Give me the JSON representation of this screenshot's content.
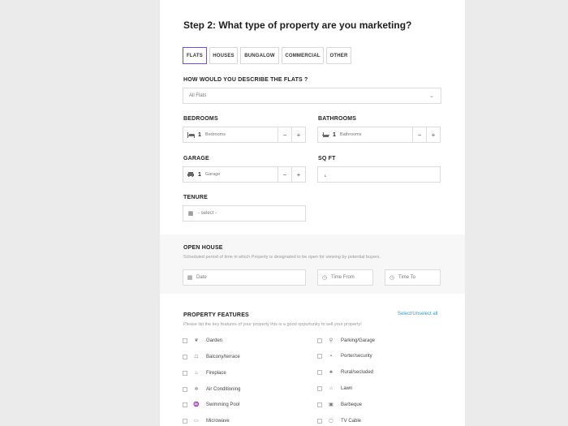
{
  "heading": "Step 2: What type of property are you marketing?",
  "property_types": [
    {
      "label": "FLATS",
      "active": true
    },
    {
      "label": "HOUSES",
      "active": false
    },
    {
      "label": "BUNGALOW",
      "active": false
    },
    {
      "label": "COMMERCIAL",
      "active": false
    },
    {
      "label": "OTHER",
      "active": false
    }
  ],
  "describe": {
    "label": "HOW WOULD YOU DESCRIBE THE FLATS ?",
    "value": "All Flats"
  },
  "bedrooms": {
    "label": "BEDROOMS",
    "value": "1",
    "unit": "Bedrooms"
  },
  "bathrooms": {
    "label": "BATHROOMS",
    "value": "1",
    "unit": "Bathrooms"
  },
  "garage": {
    "label": "GARAGE",
    "value": "1",
    "unit": "Garage"
  },
  "sqft": {
    "label": "SQ FT",
    "value": ""
  },
  "tenure": {
    "label": "TENURE",
    "placeholder": "- select -"
  },
  "open_house": {
    "label": "OPEN HOUSE",
    "description": "Scheduled period of time in which Property is designated to be open for viewing by potential buyers.",
    "date_placeholder": "Date",
    "time_from_placeholder": "Time From",
    "time_to_placeholder": "Time To"
  },
  "features": {
    "label": "PROPERTY FEATURES",
    "select_all": "Select/Unselect all",
    "description": "Please list the key features of your property this is a good oppurtunity to sell your property!",
    "left": [
      {
        "label": "Garden",
        "icon": "leaf-icon"
      },
      {
        "label": "Balcony/terrace",
        "icon": "balcony-icon"
      },
      {
        "label": "Fireplace",
        "icon": "fire-icon"
      },
      {
        "label": "Air Conditioning",
        "icon": "snowflake-icon"
      },
      {
        "label": "Swimming Pool",
        "icon": "swimmer-icon"
      },
      {
        "label": "Microwave",
        "icon": "microwave-icon"
      }
    ],
    "right": [
      {
        "label": "Parking/Garage",
        "icon": "parking-icon"
      },
      {
        "label": "Porter/security",
        "icon": "lock-icon"
      },
      {
        "label": "Rural/secluded",
        "icon": "tree-icon"
      },
      {
        "label": "Lawn",
        "icon": "house-icon"
      },
      {
        "label": "Barbeque",
        "icon": "grill-icon"
      },
      {
        "label": "TV Cable",
        "icon": "tv-icon"
      }
    ]
  }
}
